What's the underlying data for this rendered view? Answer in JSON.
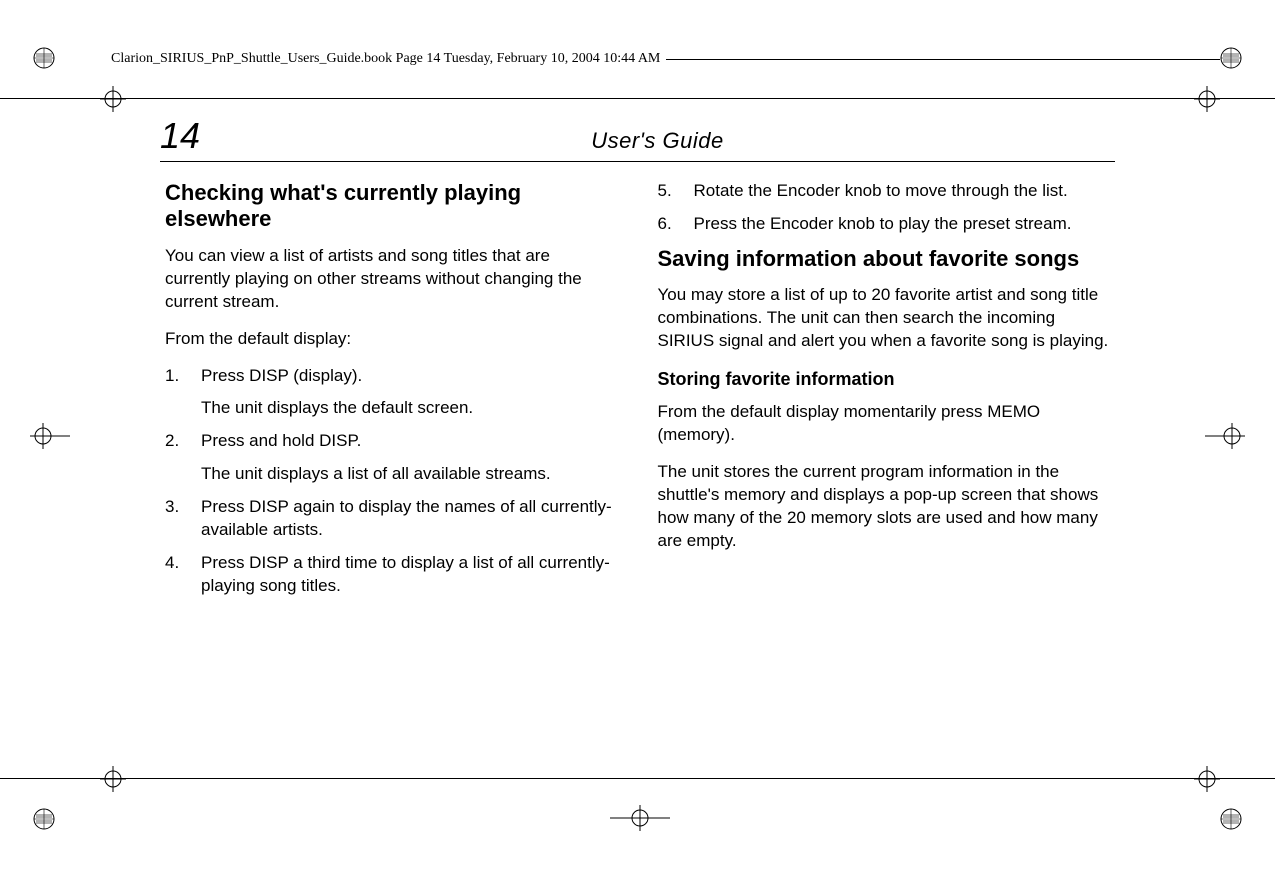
{
  "header": {
    "filename_line": "Clarion_SIRIUS_PnP_Shuttle_Users_Guide.book  Page 14  Tuesday, February 10, 2004  10:44 AM"
  },
  "page": {
    "number": "14",
    "title": "User's Guide"
  },
  "col1": {
    "heading": "Checking what's currently playing elsewhere",
    "intro": "You can view a list of artists and song titles that are currently playing on other streams without changing the current stream.",
    "lead": "From the default display:",
    "steps": [
      {
        "num": "1.",
        "text": "Press DISP (display).",
        "sub": "The unit displays the default screen."
      },
      {
        "num": "2.",
        "text": "Press and hold DISP.",
        "sub": "The unit displays a list of all available streams."
      },
      {
        "num": "3.",
        "text": "Press DISP again to display the names of all currently-available artists."
      },
      {
        "num": "4.",
        "text": "Press DISP a third time to display a list of all currently-playing song titles."
      }
    ]
  },
  "col2": {
    "steps": [
      {
        "num": "5.",
        "text": "Rotate the Encoder knob to move through the list."
      },
      {
        "num": "6.",
        "text": "Press the Encoder knob to play the preset stream."
      }
    ],
    "heading": "Saving information about favorite songs",
    "intro": "You may store a list of up to 20 favorite artist and song title combinations. The unit can then search the incoming SIRIUS signal and alert you when a favorite song is playing.",
    "subheading": "Storing favorite information",
    "p1": "From the default display momentarily press MEMO (memory).",
    "p2": "The unit stores the current program information in the shuttle's memory and displays a pop-up screen that shows how many of the 20 memory slots are used and how many are empty."
  }
}
